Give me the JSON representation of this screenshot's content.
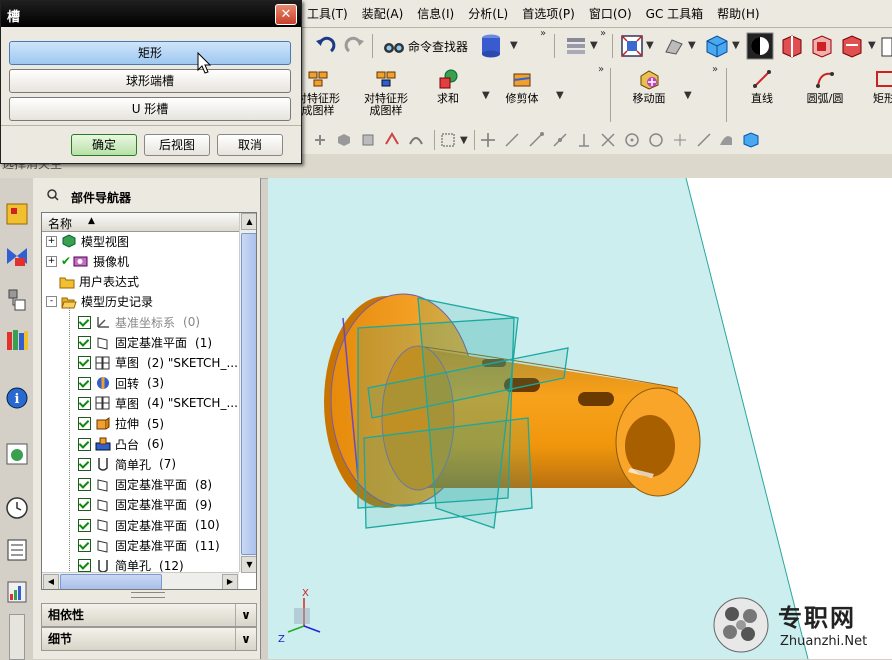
{
  "menubar": [
    "工具(T)",
    "装配(A)",
    "信息(I)",
    "分析(L)",
    "首选项(P)",
    "窗口(O)",
    "GC 工具箱",
    "帮助(H)"
  ],
  "toolbar1": {
    "command_finder": "命令查找器"
  },
  "toolbar2": {
    "pattern_feature": "对特征形\n成图样",
    "pattern_feature_cut": "对特征形\n成图样",
    "unite": "求和",
    "trim_body": "修剪体",
    "move_face": "移动面",
    "line": "直线",
    "arc": "圆弧/圆",
    "rect": "矩形"
  },
  "dialog": {
    "title": "槽",
    "options": [
      "矩形",
      "球形端槽",
      "U 形槽"
    ],
    "ok": "确定",
    "back": "后视图",
    "cancel": "取消"
  },
  "left_strip_label": "选择消失生",
  "navigator": {
    "title": "部件导航器",
    "column": "名称",
    "items": [
      {
        "label": "模型视图",
        "level": 0,
        "expand": "+",
        "icon": "model-view-icon",
        "check": false
      },
      {
        "label": "摄像机",
        "level": 0,
        "expand": "+",
        "icon": "camera-icon",
        "check": true
      },
      {
        "label": "用户表达式",
        "level": 0,
        "expand": "",
        "icon": "folder-icon",
        "check": false
      },
      {
        "label": "模型历史记录",
        "level": 0,
        "expand": "-",
        "icon": "folder-open-icon",
        "check": false
      },
      {
        "label": "基准坐标系",
        "num": "(0)",
        "level": 1,
        "icon": "csys-icon",
        "check": true,
        "dim": true
      },
      {
        "label": "固定基准平面",
        "num": "(1)",
        "level": 1,
        "icon": "plane-icon",
        "check": true
      },
      {
        "label": "草图",
        "num": "(2) \"SKETCH_...",
        "level": 1,
        "icon": "sketch-icon",
        "check": true
      },
      {
        "label": "回转",
        "num": "(3)",
        "level": 1,
        "icon": "revolve-icon",
        "check": true
      },
      {
        "label": "草图",
        "num": "(4) \"SKETCH_...",
        "level": 1,
        "icon": "sketch-icon",
        "check": true
      },
      {
        "label": "拉伸",
        "num": "(5)",
        "level": 1,
        "icon": "extrude-icon",
        "check": true
      },
      {
        "label": "凸台",
        "num": "(6)",
        "level": 1,
        "icon": "boss-icon",
        "check": true
      },
      {
        "label": "简单孔",
        "num": "(7)",
        "level": 1,
        "icon": "hole-icon",
        "check": true
      },
      {
        "label": "固定基准平面",
        "num": "(8)",
        "level": 1,
        "icon": "plane-icon",
        "check": true
      },
      {
        "label": "固定基准平面",
        "num": "(9)",
        "level": 1,
        "icon": "plane-icon",
        "check": true
      },
      {
        "label": "固定基准平面",
        "num": "(10)",
        "level": 1,
        "icon": "plane-icon",
        "check": true
      },
      {
        "label": "固定基准平面",
        "num": "(11)",
        "level": 1,
        "icon": "plane-icon",
        "check": true
      },
      {
        "label": "简单孔",
        "num": "(12)",
        "level": 1,
        "icon": "hole-icon",
        "check": true
      }
    ],
    "panels": [
      "相依性",
      "细节"
    ]
  },
  "viewport": {
    "triad": {
      "x": "X",
      "z": "Z"
    }
  },
  "watermark": {
    "brand": "专职网",
    "url": "Zhuanzhi.Net"
  },
  "colors": {
    "part": "#f59a10",
    "plane": "#1aa8a0",
    "bg": "#cfeeee"
  }
}
